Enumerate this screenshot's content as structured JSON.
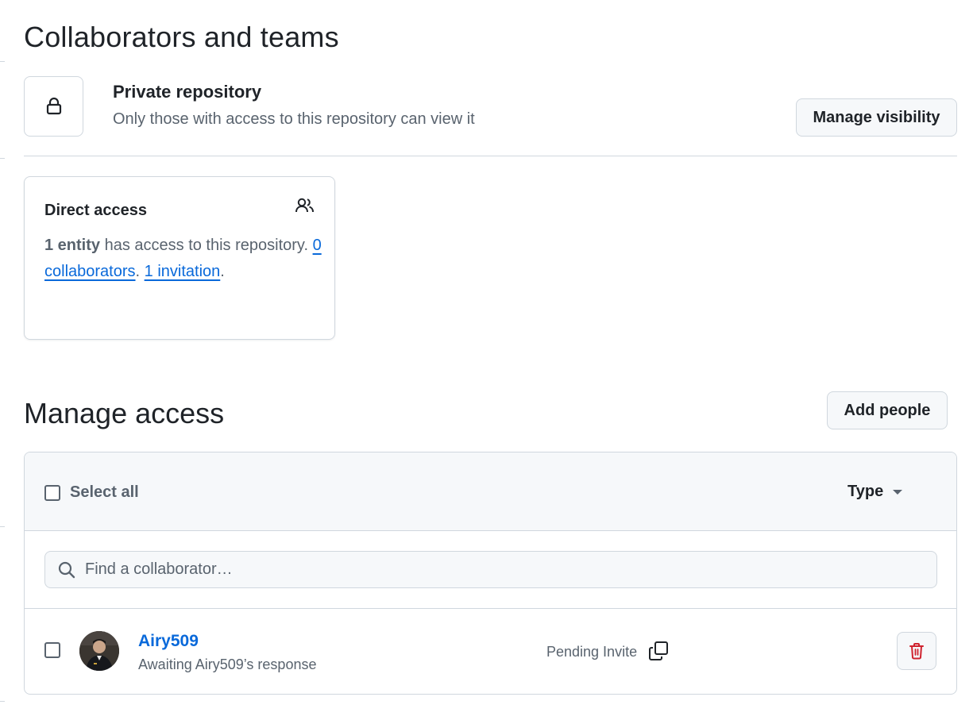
{
  "page_title": "Collaborators and teams",
  "visibility": {
    "title": "Private repository",
    "description": "Only those with access to this repository can view it",
    "button_label": "Manage visibility"
  },
  "direct_access": {
    "title": "Direct access",
    "entity_count": "1 entity",
    "text_1": " has access to this repository. ",
    "collaborators_link": "0 collaborators",
    "text_2": ". ",
    "invitation_link": "1 invitation",
    "text_3": "."
  },
  "manage_access": {
    "title": "Manage access",
    "add_button_label": "Add people",
    "select_all_label": "Select all",
    "type_filter_label": "Type",
    "search_placeholder": "Find a collaborator…",
    "members": [
      {
        "username": "Airy509",
        "status_text": "Awaiting Airy509’s response",
        "role_text": "Pending Invite"
      }
    ]
  },
  "colors": {
    "accent_link": "#0969da",
    "danger": "#cf222e",
    "border": "#d0d7de",
    "muted_text": "#59636e"
  },
  "icons": [
    "lock-icon",
    "people-icon",
    "search-icon",
    "copy-icon",
    "trash-icon",
    "caret-down-icon"
  ]
}
